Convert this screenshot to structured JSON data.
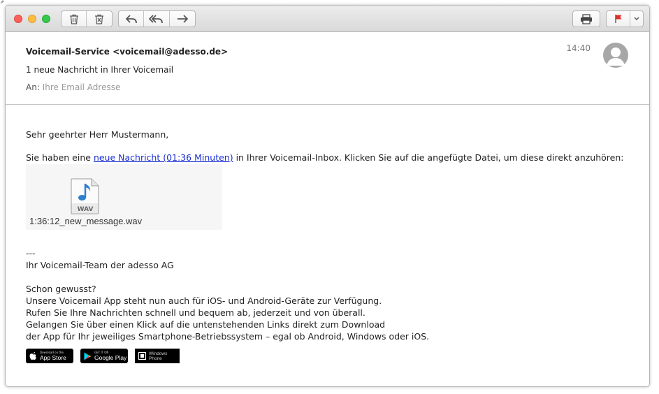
{
  "toolbar": {
    "buttons": [
      {
        "name": "delete",
        "icon": "trash-icon"
      },
      {
        "name": "junk",
        "icon": "junk-icon"
      },
      {
        "name": "reply",
        "icon": "reply-icon"
      },
      {
        "name": "reply-all",
        "icon": "reply-all-icon"
      },
      {
        "name": "forward",
        "icon": "forward-icon"
      },
      {
        "name": "print",
        "icon": "print-icon"
      },
      {
        "name": "flag",
        "icon": "flag-icon"
      },
      {
        "name": "flag-menu",
        "icon": "chevron-down-icon"
      }
    ],
    "flag_color": "#e0302b"
  },
  "header": {
    "from": "Voicemail-Service <voicemail@adesso.de>",
    "subject": "1 neue Nachricht in Ihrer Voicemail",
    "to_label": "An:",
    "to_value": "Ihre Email Adresse",
    "time": "14:40"
  },
  "body": {
    "greeting": "Sehr geehrter Herr Mustermann,",
    "intro_before": "Sie haben eine ",
    "intro_link": "neue Nachricht (01:36 Minuten)",
    "intro_after": " in Ihrer Voicemail-Inbox. Klicken Sie auf die angefügte Datei, um diese direkt anzuhören:",
    "attachment": {
      "filename": "1:36:12_new_message.wav",
      "type_label": "WAV"
    },
    "separator": "---",
    "signature": "Ihr Voicemail-Team der adesso AG",
    "promo": [
      "Schon gewusst?",
      "Unsere Voicemail App steht nun auch für iOS- und Android-Geräte zur Verfügung.",
      "Rufen Sie Ihre Nachrichten schnell und bequem ab, jederzeit und von überall.",
      "Gelangen Sie über einen Klick auf die untenstehenden Links direkt zum Download",
      "der App für Ihr jeweiliges Smartphone-Betriebssystem – egal ob Android, Windows oder iOS."
    ],
    "store_badges": [
      {
        "small": "Download on the",
        "big": "App Store",
        "icon": "apple-icon"
      },
      {
        "small": "GET IT ON",
        "big": "Google Play",
        "icon": "google-play-icon"
      },
      {
        "small": "Windows",
        "big": "Phone",
        "icon": "windows-icon"
      }
    ]
  },
  "colors": {
    "link": "#1a2fd0",
    "avatar": "#a7a7a7"
  }
}
